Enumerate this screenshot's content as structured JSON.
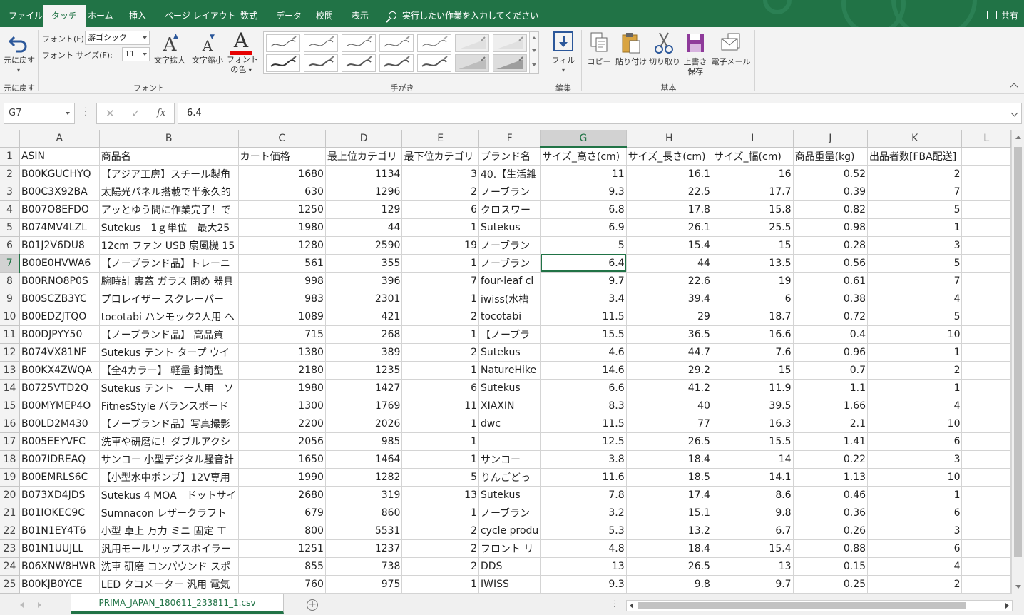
{
  "ribbon_tabs": [
    "ファイル",
    "タッチ",
    "ホーム",
    "挿入",
    "ページ レイアウト",
    "数式",
    "データ",
    "校閲",
    "表示"
  ],
  "tell_me": "実行したい作業を入力してください",
  "share": "共有",
  "ribbon": {
    "undo_label": "元に戻す",
    "undo_group": "元に戻す",
    "font_label": "フォント(F):",
    "font_value": "游ゴシック",
    "font_size_label": "フォント サイズ(F):",
    "font_size_value": "11",
    "grow_font": "文字拡大",
    "shrink_font": "文字縮小",
    "font_color_line1": "フォント",
    "font_color_line2": "の色",
    "font_group": "フォント",
    "ink_group": "手がき",
    "fill_label": "フィル",
    "edit_group": "編集",
    "copy": "コピー",
    "paste": "貼り付け",
    "cut": "切り取り",
    "save_line1": "上書き",
    "save_line2": "保存",
    "email": "電子メール",
    "basic_group": "基本",
    "accent_color": "#217346",
    "font_color_bar": "#e60000"
  },
  "formula_bar": {
    "name_box": "G7",
    "cancel": "✕",
    "enter": "✓",
    "fx": "fx",
    "value": "6.4"
  },
  "columns": [
    "A",
    "B",
    "C",
    "D",
    "E",
    "F",
    "G",
    "H",
    "I",
    "J",
    "K",
    "L"
  ],
  "header_row": [
    "ASIN",
    "商品名",
    "カート価格",
    "最上位カテゴリ",
    "最下位カテゴリ",
    "ブランド名",
    "サイズ_高さ(cm)",
    "サイズ_長さ(cm)",
    "サイズ_幅(cm)",
    "商品重量(kg)",
    "出品者数[FBA配送]",
    ""
  ],
  "rows": [
    [
      "B00KGUCHYQ",
      "【アジア工房】スチール製角",
      "1680",
      "1134",
      "3",
      "40.【生活雑",
      "11",
      "16.1",
      "16",
      "0.52",
      "2",
      ""
    ],
    [
      "B00C3X92BA",
      "太陽光パネル搭載で半永久的",
      "630",
      "1296",
      "2",
      "ノーブラン",
      "9.3",
      "22.5",
      "17.7",
      "0.39",
      "7",
      ""
    ],
    [
      "B007O8EFDO",
      "アッとゆう間に作業完了！で",
      "1250",
      "129",
      "6",
      "クロスワー",
      "6.8",
      "17.8",
      "15.8",
      "0.82",
      "5",
      ""
    ],
    [
      "B074MV4LZL",
      "Sutekus　1ｇ単位　最大25",
      "1980",
      "44",
      "1",
      "Sutekus",
      "6.9",
      "26.1",
      "25.5",
      "0.98",
      "1",
      ""
    ],
    [
      "B01J2V6DU8",
      "12cm ファン USB 扇風機 15",
      "1280",
      "2590",
      "19",
      "ノーブラン",
      "5",
      "15.4",
      "15",
      "0.28",
      "3",
      ""
    ],
    [
      "B00E0HVWA6",
      "【ノーブランド品】トレーニ",
      "561",
      "355",
      "1",
      "ノーブラン",
      "6.4",
      "44",
      "13.5",
      "0.56",
      "5",
      ""
    ],
    [
      "B00RNO8P0S",
      "腕時計 裏蓋 ガラス 閉め 器具",
      "998",
      "396",
      "7",
      "four-leaf cl",
      "9.7",
      "22.6",
      "19",
      "0.61",
      "7",
      ""
    ],
    [
      "B00SCZB3YC",
      "プロレイザー スクレーパー",
      "983",
      "2301",
      "1",
      "iwiss(水槽",
      "3.4",
      "39.4",
      "6",
      "0.38",
      "4",
      ""
    ],
    [
      "B00EDZJTQO",
      "tocotabi ハンモック2人用 へ",
      "1089",
      "421",
      "2",
      "tocotabi",
      "11.5",
      "29",
      "18.7",
      "0.72",
      "5",
      ""
    ],
    [
      "B00DJPYY50",
      "【ノーブランド品】 高品質",
      "715",
      "268",
      "1",
      "【ノーブラ",
      "15.5",
      "36.5",
      "16.6",
      "0.4",
      "10",
      ""
    ],
    [
      "B074VX81NF",
      "Sutekus テント タープ ウイ",
      "1380",
      "389",
      "2",
      "Sutekus",
      "4.6",
      "44.7",
      "7.6",
      "0.96",
      "1",
      ""
    ],
    [
      "B00KX4ZWQA",
      "【全4カラー】 軽量 封筒型",
      "2180",
      "1235",
      "1",
      "NatureHike",
      "14.6",
      "29.2",
      "15",
      "0.7",
      "2",
      ""
    ],
    [
      "B0725VTD2Q",
      "Sutekus テント　一人用　ソ",
      "1980",
      "1427",
      "6",
      "Sutekus",
      "6.6",
      "41.2",
      "11.9",
      "1.1",
      "1",
      ""
    ],
    [
      "B00MYMEP4O",
      "FitnesStyle バランスボード",
      "1300",
      "1769",
      "11",
      "XIAXIN",
      "8.3",
      "40",
      "39.5",
      "1.66",
      "4",
      ""
    ],
    [
      "B00LD2M430",
      "【ノーブランド品】写真撮影",
      "2200",
      "2026",
      "1",
      "dwc",
      "11.5",
      "77",
      "16.3",
      "2.1",
      "10",
      ""
    ],
    [
      "B005EEYVFC",
      "洗車や研磨に！ダブルアクシ",
      "2056",
      "985",
      "1",
      "",
      "12.5",
      "26.5",
      "15.5",
      "1.41",
      "6",
      ""
    ],
    [
      "B007IDREAQ",
      "サンコー 小型デジタル騒音計",
      "1650",
      "1464",
      "1",
      "サンコー",
      "3.8",
      "18.4",
      "14",
      "0.22",
      "3",
      ""
    ],
    [
      "B00EMRLS6C",
      "【小型水中ポンプ】12V専用",
      "1990",
      "1282",
      "5",
      "りんごどっ",
      "11.6",
      "18.5",
      "14.1",
      "1.13",
      "10",
      ""
    ],
    [
      "B073XD4JDS",
      "Sutekus 4 MOA　ドットサイ",
      "2680",
      "319",
      "13",
      "Sutekus",
      "7.8",
      "17.4",
      "8.6",
      "0.46",
      "1",
      ""
    ],
    [
      "B01IOKEC9C",
      "Sumnacon レザークラフト",
      "679",
      "860",
      "1",
      "ノーブラン",
      "3.2",
      "15.1",
      "9.8",
      "0.36",
      "6",
      ""
    ],
    [
      "B01N1EY4T6",
      "小型 卓上 万力 ミニ 固定 工",
      "800",
      "5531",
      "2",
      "cycle produ",
      "5.3",
      "13.2",
      "6.7",
      "0.26",
      "3",
      ""
    ],
    [
      "B01N1UUJLL",
      "汎用モールリップスポイラー",
      "1251",
      "1237",
      "2",
      "フロント リ",
      "4.8",
      "18.4",
      "15.4",
      "0.88",
      "6",
      ""
    ],
    [
      "B06XNW8HWR",
      "洗車 研磨 コンパウンド スポ",
      "855",
      "738",
      "2",
      "DDS",
      "13",
      "26.5",
      "13",
      "0.15",
      "4",
      ""
    ],
    [
      "B00KJB0YCE",
      "LED タコメーター 汎用 電気",
      "760",
      "975",
      "1",
      "IWISS",
      "9.3",
      "9.8",
      "9.7",
      "0.25",
      "2",
      ""
    ]
  ],
  "selected_cell": "G7",
  "sheet_tab": "PRIMA_JAPAN_180611_233811_1.csv",
  "add_sheet": "+"
}
